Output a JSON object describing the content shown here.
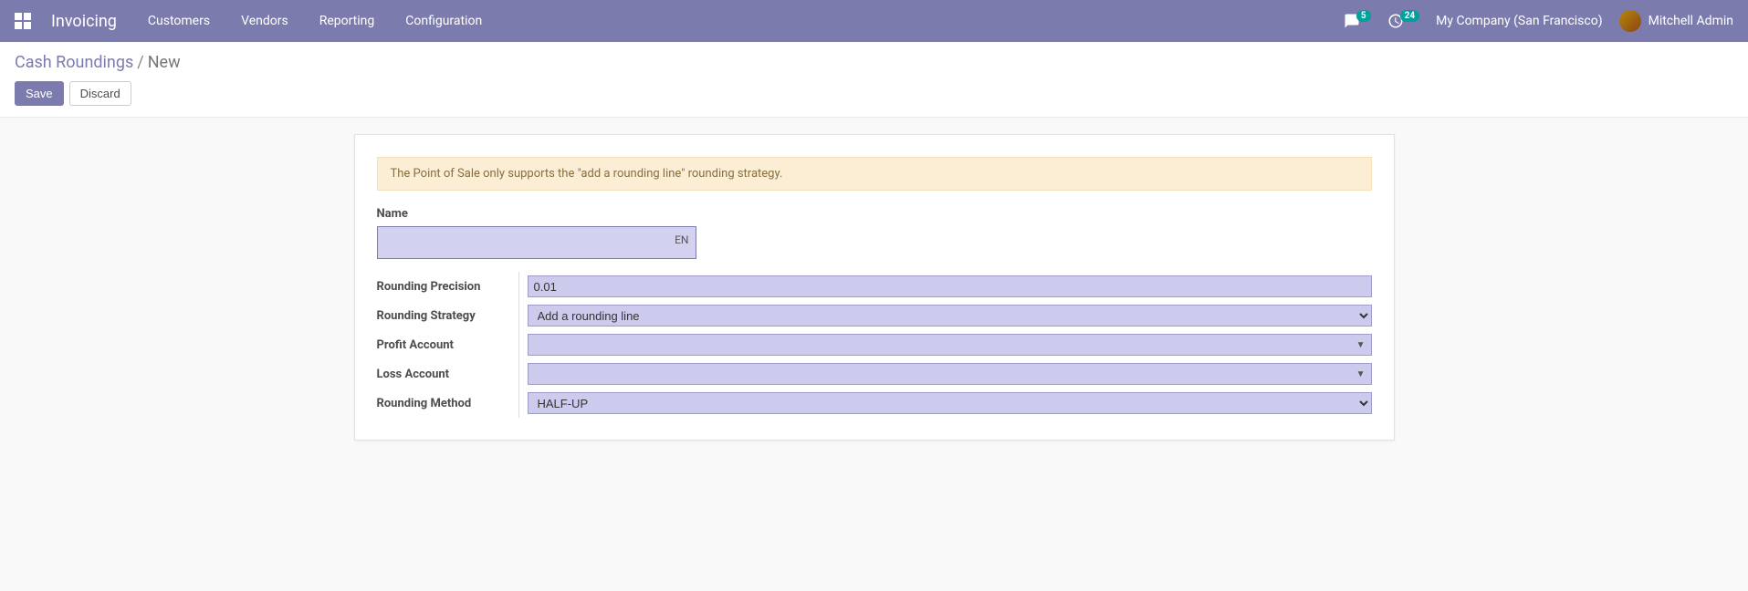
{
  "navbar": {
    "app_title": "Invoicing",
    "menu": [
      "Customers",
      "Vendors",
      "Reporting",
      "Configuration"
    ],
    "messages_badge": "5",
    "activities_badge": "24",
    "company": "My Company (San Francisco)",
    "user": "Mitchell Admin"
  },
  "control_panel": {
    "breadcrumb_parent": "Cash Roundings",
    "breadcrumb_current": "New",
    "save": "Save",
    "discard": "Discard"
  },
  "form": {
    "alert": "The Point of Sale only supports the \"add a rounding line\" rounding strategy.",
    "name_label": "Name",
    "name_value": "",
    "lang": "EN",
    "rows": {
      "precision_label": "Rounding Precision",
      "precision_value": "0.01",
      "strategy_label": "Rounding Strategy",
      "strategy_value": "Add a rounding line",
      "profit_label": "Profit Account",
      "profit_value": "",
      "loss_label": "Loss Account",
      "loss_value": "",
      "method_label": "Rounding Method",
      "method_value": "HALF-UP"
    }
  }
}
